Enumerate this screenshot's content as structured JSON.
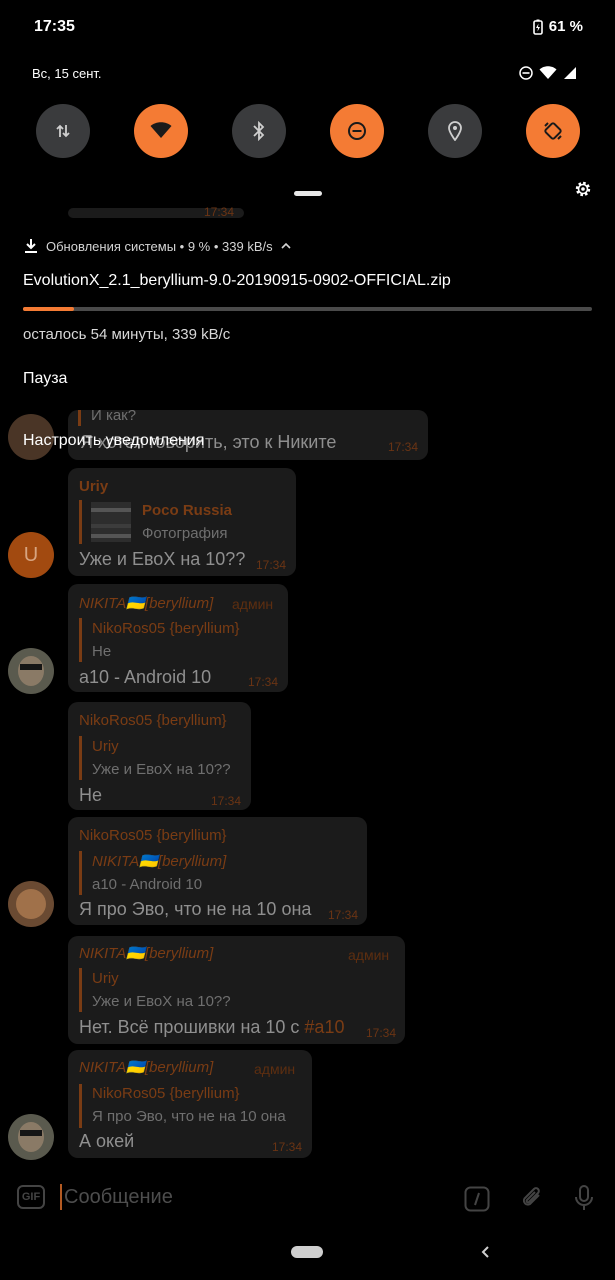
{
  "status_bar": {
    "time": "17:35",
    "battery": "61 %",
    "date": "Вс, 15 сент."
  },
  "quick_tiles": [
    {
      "name": "mobile-data",
      "icon": "data-arrows-icon",
      "state": "off"
    },
    {
      "name": "wifi",
      "icon": "wifi-icon",
      "state": "on"
    },
    {
      "name": "bluetooth",
      "icon": "bluetooth-icon",
      "state": "off"
    },
    {
      "name": "dnd",
      "icon": "do-not-disturb-icon",
      "state": "on"
    },
    {
      "name": "location",
      "icon": "location-pin-icon",
      "state": "off"
    },
    {
      "name": "auto-rotate",
      "icon": "auto-rotate-icon",
      "state": "on"
    }
  ],
  "notification": {
    "app_line": "Обновления системы • 9 % • 339 kB/s",
    "title": "EvolutionX_2.1_beryllium-9.0-20190915-0902-OFFICIAL.zip",
    "progress": 0.09,
    "subtitle": "осталось 54 минуты, 339 kB/с",
    "pause_label": "Пауза",
    "manage_label": "Настроить уведомления"
  },
  "chat": {
    "partial_top": {
      "quote_text": "И как?",
      "text": "Я хотел говорить, это к Никите",
      "time": "17:34"
    },
    "messages": [
      {
        "sender": "Uriy",
        "quote_name": "Poco Russia",
        "quote_text": "Фотография",
        "text": "Уже и ЕвоX на 10??",
        "time": "17:34",
        "avatar_letter": "U"
      },
      {
        "sender": "NIKITA🇺🇦[beryllium]",
        "admin": "админ",
        "quote_name": "NikoRos05 {beryllium}",
        "quote_text": "Не",
        "text": "a10 - Android 10",
        "time": "17:34"
      },
      {
        "sender": "NikoRos05 {beryllium}",
        "quote_name": "Uriy",
        "quote_text": "Уже и ЕвоX на 10??",
        "text": "Не",
        "time": "17:34"
      },
      {
        "sender": "NikoRos05 {beryllium}",
        "quote_name": "NIKITA🇺🇦[beryllium]",
        "quote_text": "a10 - Android 10",
        "text": "Я про Эво, что не на 10 она",
        "time": "17:34"
      },
      {
        "sender": "NIKITA🇺🇦[beryllium]",
        "admin": "админ",
        "quote_name": "Uriy",
        "quote_text": "Уже и ЕвоX на 10??",
        "text": "Нет. Всё прошивки на 10 с ",
        "hashtag": "#a10",
        "time": "17:34"
      },
      {
        "sender": "NIKITA🇺🇦[beryllium]",
        "admin": "админ",
        "quote_name": "NikoRos05 {beryllium}",
        "quote_text": "Я про Эво, что не на 10 она",
        "text": "А окей",
        "time": "17:34"
      }
    ]
  },
  "input": {
    "gif_label": "GIF",
    "placeholder": "Сообщение"
  },
  "colors": {
    "accent": "#f47b34",
    "tile_off": "#3a3b3d"
  }
}
